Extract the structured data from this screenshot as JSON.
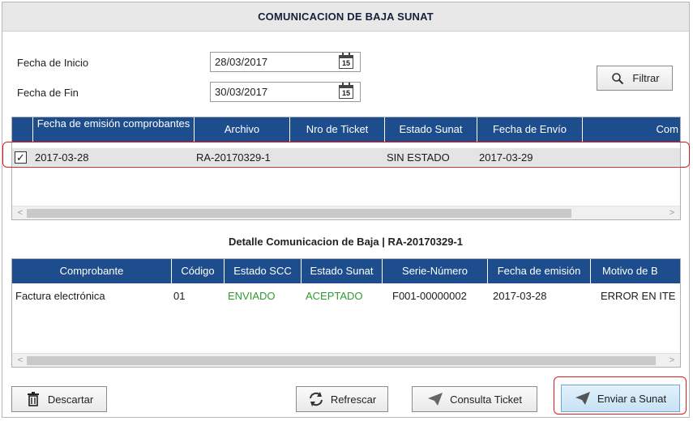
{
  "window": {
    "title": "COMUNICACION DE BAJA SUNAT"
  },
  "filters": {
    "start_label": "Fecha de Inicio",
    "start_value": "28/03/2017",
    "end_label": "Fecha de Fin",
    "end_value": "30/03/2017",
    "calendar_day": "15",
    "filter_button": "Filtrar"
  },
  "summary_grid": {
    "headers": [
      "Fecha de emisión comprobantes",
      "Archivo",
      "Nro de Ticket",
      "Estado Sunat",
      "Fecha de Envío",
      "Com"
    ],
    "rows": [
      {
        "checked": true,
        "fecha": "2017-03-28",
        "archivo": "RA-20170329-1",
        "ticket": "",
        "estado": "SIN ESTADO",
        "envio": "2017-03-29"
      }
    ]
  },
  "detail": {
    "title": "Detalle Comunicacion de Baja | RA-20170329-1",
    "headers": [
      "Comprobante",
      "Código",
      "Estado SCC",
      "Estado Sunat",
      "Serie-Número",
      "Fecha de emisión",
      "Motivo de B"
    ],
    "rows": [
      {
        "comprobante": "Factura electrónica",
        "codigo": "01",
        "estado_scc": "ENVIADO",
        "estado_sunat": "ACEPTADO",
        "serie": "F001-00000002",
        "fecha": "2017-03-28",
        "motivo": "ERROR EN ITE"
      }
    ]
  },
  "actions": {
    "discard": "Descartar",
    "refresh": "Refrescar",
    "check_ticket": "Consulta Ticket",
    "send": "Enviar a Sunat"
  },
  "colors": {
    "header_bg": "#1d4d8c",
    "status_green": "#2e9b2e",
    "highlight_red": "#e01b1b"
  }
}
